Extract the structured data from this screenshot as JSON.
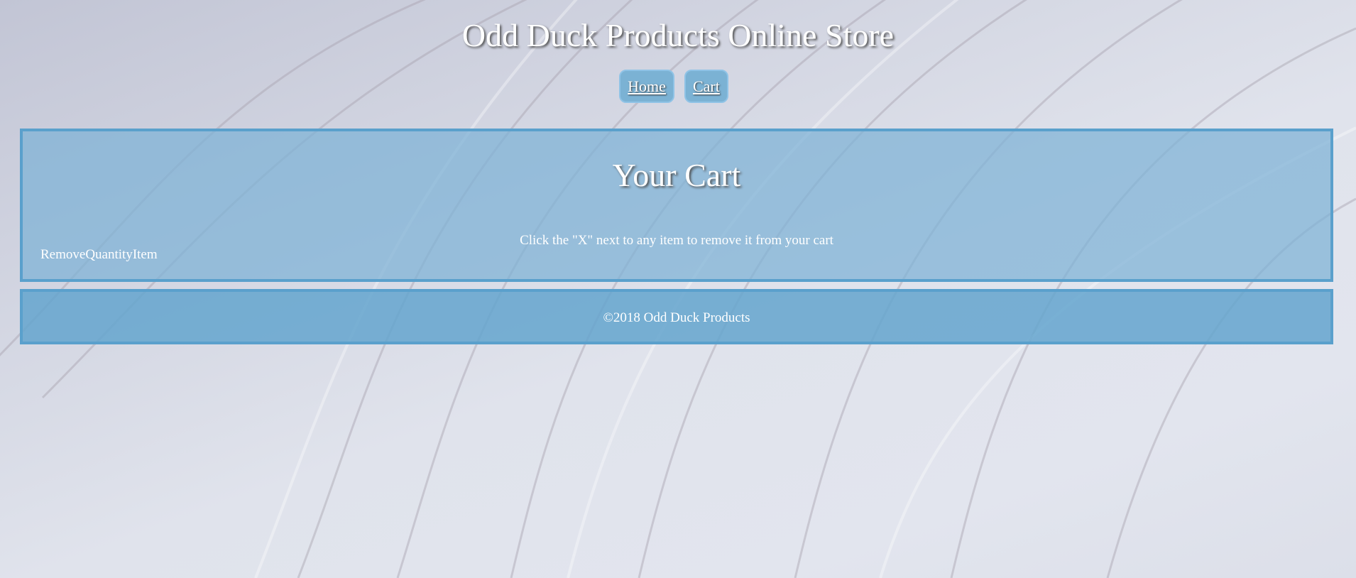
{
  "header": {
    "title": "Odd Duck Products Online Store",
    "nav": [
      {
        "label": "Home"
      },
      {
        "label": "Cart"
      }
    ]
  },
  "cart": {
    "title": "Your Cart",
    "instructions": "Click the \"X\" next to any item to remove it from your cart",
    "columns": [
      "Remove",
      "Quantity",
      "Item"
    ]
  },
  "footer": {
    "copyright": "©2018 Odd Duck Products"
  },
  "colors": {
    "panel_fill": "#7db2d5",
    "panel_border": "#5aa0cc",
    "nav_button": "#7bb2d4",
    "text": "#ffffff"
  }
}
